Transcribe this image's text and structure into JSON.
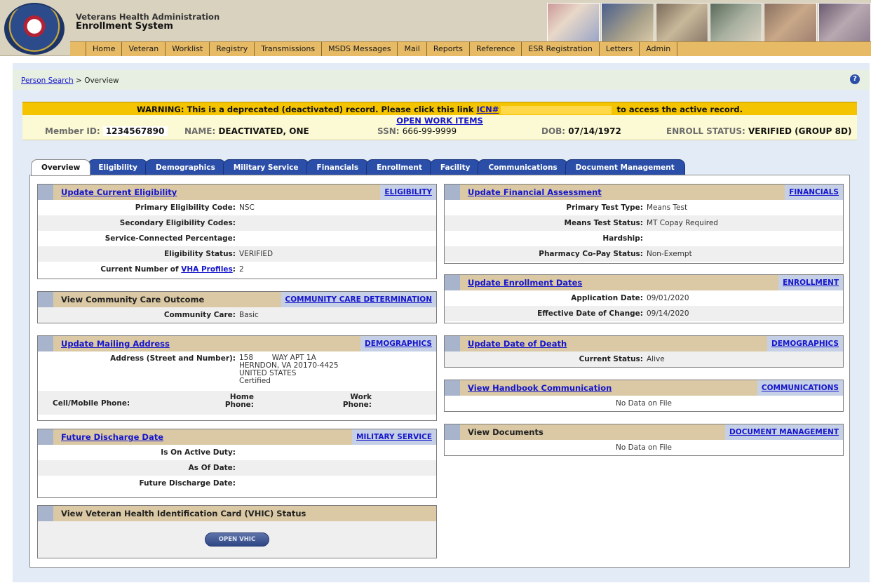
{
  "header": {
    "org_name": "Veterans Health Administration",
    "system_name": "Enrollment System",
    "seal_icon": "va-seal-icon",
    "menu": [
      "Home",
      "Veteran",
      "Worklist",
      "Registry",
      "Transmissions",
      "MSDS Messages",
      "Mail",
      "Reports",
      "Reference",
      "ESR Registration",
      "Letters",
      "Admin"
    ]
  },
  "breadcrumb": {
    "link": "Person Search",
    "separator": ">",
    "current": "Overview"
  },
  "help_icon": "?",
  "warning": {
    "text_before": "WARNING: This is a deprecated (deactivated) record. Please click this link",
    "link": "ICN#",
    "text_after": "to access the active record."
  },
  "open_work_items": "OPEN WORK ITEMS",
  "person": {
    "member_id_label": "Member ID:",
    "member_id": "1234567890",
    "name_label": "NAME:",
    "name": "DEACTIVATED, ONE",
    "ssn_label": "SSN:",
    "ssn": "666-99-9999",
    "dob_label": "DOB:",
    "dob": "07/14/1972",
    "enroll_status_label": "ENROLL STATUS:",
    "enroll_status": "VERIFIED (GROUP 8D)"
  },
  "tabs": [
    "Overview",
    "Eligibility",
    "Demographics",
    "Military Service",
    "Financials",
    "Enrollment",
    "Facility",
    "Communications",
    "Document Management"
  ],
  "panels": {
    "eligibility": {
      "title": "Update Current Eligibility",
      "link": "ELIGIBILITY",
      "rows": [
        {
          "label": "Primary Eligibility Code:",
          "value": "NSC"
        },
        {
          "label": "Secondary Eligibility Codes:",
          "value": ""
        },
        {
          "label": "Service-Connected Percentage:",
          "value": ""
        },
        {
          "label": "Eligibility Status:",
          "value": "VERIFIED"
        }
      ],
      "profiles_prefix": "Current Number of",
      "profiles_link": "VHA Profiles",
      "profiles_suffix": ":",
      "profiles_value": "2"
    },
    "community": {
      "title": "View Community Care Outcome",
      "link": "COMMUNITY CARE DETERMINATION",
      "label": "Community Care:",
      "value": "Basic"
    },
    "mailing": {
      "title": "Update Mailing Address",
      "link": "DEMOGRAPHICS",
      "address_label": "Address (Street and Number):",
      "address_lines": [
        "158        WAY APT 1A",
        "HERNDON, VA 20170-4425",
        "UNITED STATES",
        "Certified"
      ],
      "cell_label": "Cell/Mobile Phone:",
      "home_label_1": "Home",
      "home_label_2": "Phone:",
      "work_label_1": "Work",
      "work_label_2": "Phone:"
    },
    "discharge": {
      "title": "Future Discharge Date",
      "link": "MILITARY SERVICE",
      "rows": [
        {
          "label": "Is On Active Duty:",
          "value": ""
        },
        {
          "label": "As Of Date:",
          "value": ""
        },
        {
          "label": "Future Discharge Date:",
          "value": ""
        }
      ]
    },
    "vhic": {
      "title": "View Veteran Health Identification Card (VHIC) Status",
      "button": "OPEN VHIC"
    },
    "financial": {
      "title": "Update Financial Assessment",
      "link": "FINANCIALS",
      "rows": [
        {
          "label": "Primary Test Type:",
          "value": "Means Test"
        },
        {
          "label": "Means Test Status:",
          "value": "MT Copay Required"
        },
        {
          "label": "Hardship:",
          "value": ""
        },
        {
          "label": "Pharmacy Co-Pay Status:",
          "value": "Non-Exempt"
        }
      ]
    },
    "enrollment": {
      "title": "Update Enrollment Dates",
      "link": "ENROLLMENT",
      "rows": [
        {
          "label": "Application Date:",
          "value": "09/01/2020"
        },
        {
          "label": "Effective Date of Change:",
          "value": "09/14/2020"
        }
      ]
    },
    "death": {
      "title": "Update Date of Death",
      "link": "DEMOGRAPHICS",
      "label": "Current Status:",
      "value": "Alive"
    },
    "handbook": {
      "title": "View Handbook Communication",
      "link": "COMMUNICATIONS",
      "empty": "No Data on File"
    },
    "documents": {
      "title": "View Documents",
      "link": "DOCUMENT MANAGEMENT",
      "empty": "No Data on File"
    }
  },
  "colors": {
    "menu_bar": "#e7bb66",
    "warning": "#f5c400",
    "tab_active": "#ffffff",
    "tab_inactive": "#2b4fa8",
    "panel_header": "#dac9a4",
    "link": "#1515cc"
  }
}
